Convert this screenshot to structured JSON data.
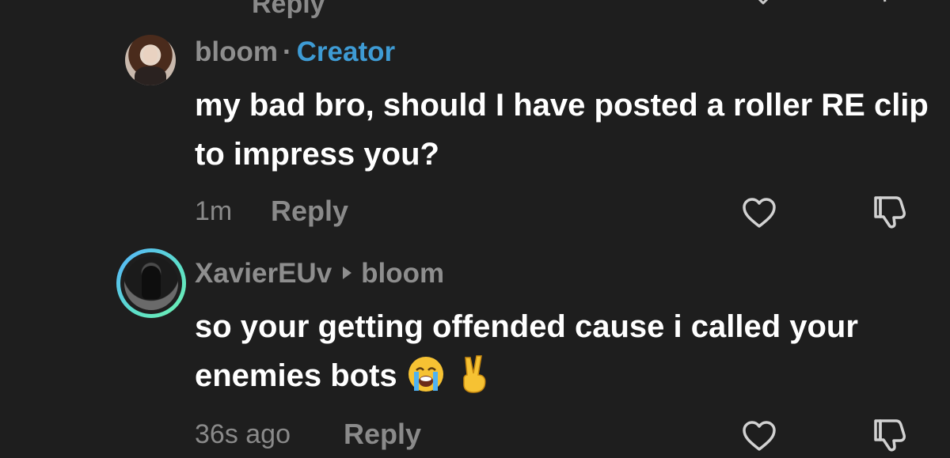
{
  "top_partial": {
    "reply_label": "Reply"
  },
  "comments": [
    {
      "username": "bloom",
      "separator": "·",
      "badge": "Creator",
      "text": "my bad bro, should I have posted a roller RE clip to impress you?",
      "time": "1m",
      "reply_label": "Reply"
    },
    {
      "username": "XavierEUv",
      "reply_to": "bloom",
      "text_parts": [
        "so your getting offended cause i called your enemies bots"
      ],
      "emojis": [
        "loudly-crying-face-icon",
        "victory-hand-icon"
      ],
      "time": "36s ago",
      "reply_label": "Reply"
    }
  ],
  "colors": {
    "background": "#1e1e1e",
    "creator_badge": "#3e9bd4",
    "muted_text": "#8e8e8e",
    "primary_text": "#ffffff",
    "story_ring_start": "#55b2ff",
    "story_ring_end": "#6ef0b0"
  }
}
